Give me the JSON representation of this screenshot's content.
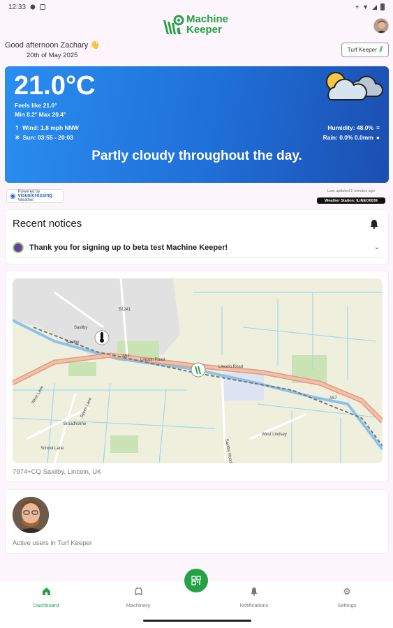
{
  "status_bar": {
    "time": "12:33"
  },
  "header": {
    "logo_line1": "Machine",
    "logo_line2": "Keeper",
    "greeting": "Good afternoon Zachary 👋",
    "date": "20th of May 2025",
    "org_chip": "Turf Keeper"
  },
  "weather": {
    "temperature": "21.0°C",
    "feels_like": "Feels like 21.0°",
    "min_max": "Min 8.2° Max 20.4°",
    "wind": "Wind: 1.8 mph NNW",
    "sun": "Sun: 03:55 - 20:03",
    "humidity": "Humidity: 48.0%",
    "rain": "Rain: 0.0% 0.0mm",
    "summary": "Partly cloudy throughout the day.",
    "powered_by": "visualcrossing",
    "powered_label": "Powered by",
    "powered_sub": "Weather",
    "last_updated": "Last updated 2 minutes ago",
    "station": "Weather Station: ILINEO0039"
  },
  "notices": {
    "title": "Recent notices",
    "items": [
      {
        "text": "Thank you for signing up to beta test Machine Keeper!"
      }
    ]
  },
  "map": {
    "address": "7974+CQ Saxilby, Lincoln, UK",
    "labels": {
      "town": "Saxilby",
      "town2": "Saxilby",
      "road_b": "B1241",
      "road_a57": "A57",
      "road_a57b": "A57",
      "lincoln_road": "Lincoln Road",
      "lincoln_road2": "Lincoln Road",
      "sykes_lane": "Sykes Lane",
      "west_lane": "West Lane",
      "broadholme": "Broadholme",
      "school_lane": "School Lane",
      "west_lindsey": "West Lindsey",
      "saxilby_road": "Saxilby Road"
    }
  },
  "users": {
    "label": "Active users in Turf Keeper"
  },
  "nav": {
    "items": [
      {
        "label": "Dashboard"
      },
      {
        "label": "Machinery"
      },
      {
        "label": "Notifications"
      },
      {
        "label": "Settings"
      }
    ]
  },
  "colors": {
    "brand": "#25a244",
    "weather_start": "#2a8ef0",
    "weather_end": "#1b4fb0"
  }
}
